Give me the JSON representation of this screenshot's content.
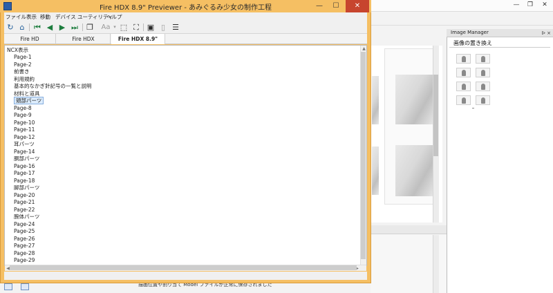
{
  "previewer": {
    "title": "Fire HDX 8.9\" Previewer - あみぐるみ少女の制作工程",
    "menu": [
      "ファイル",
      "表示",
      "移動",
      "デバイス",
      "ユーティリティ",
      "ヘルプ"
    ],
    "toolbar": {
      "font_label": "Aa"
    },
    "device_tabs": [
      "Fire HD",
      "Fire HDX",
      "Fire HDX 8.9\""
    ],
    "active_device_tab": "Fire HDX 8.9\"",
    "ncx": {
      "title": "NCX表示",
      "items": [
        "Page-1",
        "Page-2",
        "前書き",
        "利用規約",
        "基本的なかぎ針記号の一覧と説明",
        "材料と道具",
        "頭部パーツ",
        "Page-8",
        "Page-9",
        "Page-10",
        "Page-11",
        "Page-12",
        "耳パーツ",
        "Page-14",
        "胴部パーツ",
        "Page-16",
        "Page-17",
        "Page-18",
        "脚部パーツ",
        "Page-20",
        "Page-21",
        "Page-22",
        "腕体パーツ",
        "Page-24",
        "Page-25",
        "Page-26",
        "Page-27",
        "Page-28",
        "Page-29"
      ],
      "selected": "頭部パーツ"
    },
    "window_controls": {
      "minimize": "—",
      "maximize": "☐",
      "close": "✕"
    }
  },
  "image_manager": {
    "title": "Image Manager",
    "subtitle": "画像の置き換え",
    "controls": "ᐅ ×",
    "thumbnail_count": 8
  },
  "background": {
    "window_controls": {
      "minimize": "—",
      "restore": "❐",
      "close": "✕"
    },
    "status_text": "描画位置や割り当て Model ファイルが正常に保存されました"
  },
  "colors": {
    "previewer_frame": "#f5bf63",
    "close_button": "#c7452e",
    "selection": "#dcecfc"
  }
}
